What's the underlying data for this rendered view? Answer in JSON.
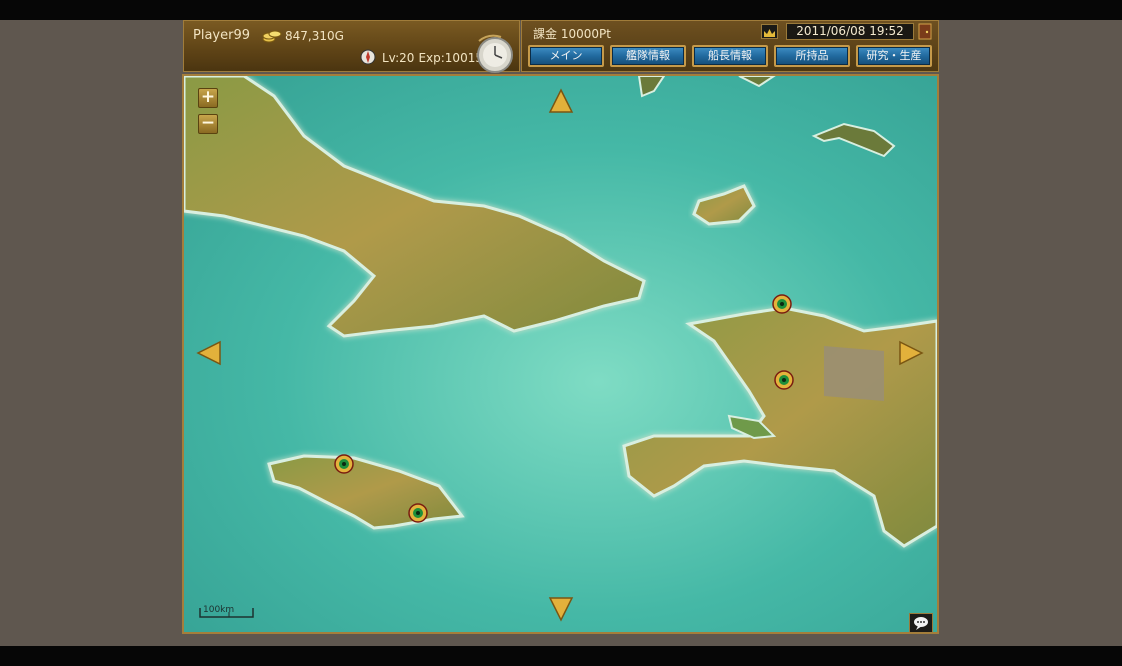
{
  "header": {
    "player_name": "Player99",
    "gold": "847,310G",
    "level": "Lv:20",
    "exp": "Exp:10015",
    "points": "課金 10000Pt",
    "datetime": "2011/06/08 19:52"
  },
  "menu": [
    {
      "label": "メイン"
    },
    {
      "label": "艦隊情報"
    },
    {
      "label": "船長情報"
    },
    {
      "label": "所持品"
    },
    {
      "label": "研究・生産"
    }
  ],
  "map": {
    "zoom_in_label": "+",
    "zoom_out_label": "−",
    "scale_label": "100km",
    "ports": [
      {
        "name": "port-marker-1"
      },
      {
        "name": "port-marker-2"
      },
      {
        "name": "port-marker-3"
      },
      {
        "name": "port-marker-4"
      }
    ]
  },
  "colors": {
    "sea": "#3fb1a3",
    "land": "#8a9a4a",
    "frame_gold": "#a47e3b",
    "button_blue": "#216a9f"
  },
  "icons": [
    "coin-icon",
    "compass-icon",
    "pocketwatch-icon",
    "crown-icon",
    "door-icon",
    "arrow-up-icon",
    "arrow-down-icon",
    "arrow-left-icon",
    "arrow-right-icon",
    "chat-icon",
    "port-icon"
  ]
}
